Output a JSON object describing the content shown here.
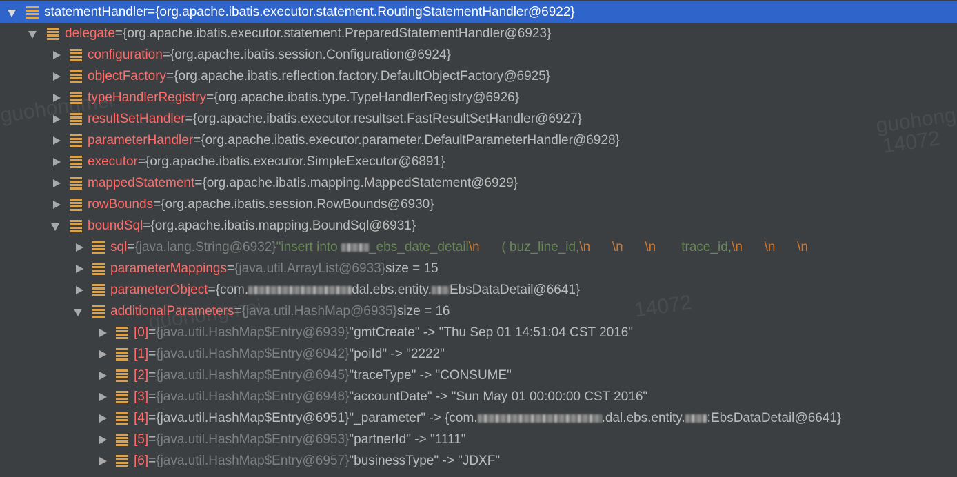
{
  "watermarks": [
    "guohongmei",
    "14072",
    "guohongmei",
    "14072",
    "guohongmei"
  ],
  "rows": [
    {
      "depth": 0,
      "state": "expanded",
      "selected": true,
      "name": "statementHandler",
      "eq": " = ",
      "value": "{org.apache.ibatis.executor.statement.RoutingStatementHandler@6922}"
    },
    {
      "depth": 1,
      "state": "expanded",
      "name": "delegate",
      "eq": " = ",
      "value": "{org.apache.ibatis.executor.statement.PreparedStatementHandler@6923}"
    },
    {
      "depth": 2,
      "state": "collapsed",
      "name": "configuration",
      "eq": " = ",
      "value": "{org.apache.ibatis.session.Configuration@6924}"
    },
    {
      "depth": 2,
      "state": "collapsed",
      "name": "objectFactory",
      "eq": " = ",
      "value": "{org.apache.ibatis.reflection.factory.DefaultObjectFactory@6925}"
    },
    {
      "depth": 2,
      "state": "collapsed",
      "name": "typeHandlerRegistry",
      "eq": " = ",
      "value": "{org.apache.ibatis.type.TypeHandlerRegistry@6926}"
    },
    {
      "depth": 2,
      "state": "collapsed",
      "name": "resultSetHandler",
      "eq": " = ",
      "value": "{org.apache.ibatis.executor.resultset.FastResultSetHandler@6927}"
    },
    {
      "depth": 2,
      "state": "collapsed",
      "name": "parameterHandler",
      "eq": " = ",
      "value": "{org.apache.ibatis.executor.parameter.DefaultParameterHandler@6928}"
    },
    {
      "depth": 2,
      "state": "collapsed",
      "name": "executor",
      "eq": " = ",
      "value": "{org.apache.ibatis.executor.SimpleExecutor@6891}"
    },
    {
      "depth": 2,
      "state": "collapsed",
      "name": "mappedStatement",
      "eq": " = ",
      "value": "{org.apache.ibatis.mapping.MappedStatement@6929}"
    },
    {
      "depth": 2,
      "state": "collapsed",
      "name": "rowBounds",
      "eq": " = ",
      "value": "{org.apache.ibatis.session.RowBounds@6930}"
    },
    {
      "depth": 2,
      "state": "expanded",
      "name": "boundSql",
      "eq": " = ",
      "value": "{org.apache.ibatis.mapping.BoundSql@6931}"
    },
    {
      "depth": 3,
      "state": "collapsed",
      "name": "sql",
      "eq": " = ",
      "type": "{java.lang.String@6932}",
      "sql": {
        "p1": "\"insert into ",
        "p2": "_ebs_date_detail",
        "esc1": "\\n",
        "p3": "      ( buz_line_id,",
        "esc2": "\\n",
        "esc3": "      \\n",
        "esc4": "      \\n",
        "p4": "       trace_id,",
        "esc5": "\\n",
        "esc6": "      \\n",
        "esc7": "      \\n"
      }
    },
    {
      "depth": 3,
      "state": "collapsed",
      "name": "parameterMappings",
      "eq": " = ",
      "type": "{java.util.ArrayList@6933}",
      "value": " size = 15"
    },
    {
      "depth": 3,
      "state": "collapsed",
      "name": "parameterObject",
      "eq": " = ",
      "po": {
        "a": "{com.",
        "b": "dal.ebs.entity.",
        "c": "EbsDataDetail@6641}"
      }
    },
    {
      "depth": 3,
      "state": "expanded",
      "name": "additionalParameters",
      "eq": " = ",
      "type": "{java.util.HashMap@6935}",
      "value": " size = 16"
    },
    {
      "depth": 4,
      "state": "collapsed",
      "name": "[0]",
      "eq": " = ",
      "type": "{java.util.HashMap$Entry@6939}",
      "value": "\"gmtCreate\" -> \"Thu Sep 01 14:51:04 CST 2016\""
    },
    {
      "depth": 4,
      "state": "collapsed",
      "name": "[1]",
      "eq": " = ",
      "type": "{java.util.HashMap$Entry@6942}",
      "value": "\"poiId\" -> \"2222\""
    },
    {
      "depth": 4,
      "state": "collapsed",
      "name": "[2]",
      "eq": " = ",
      "type": "{java.util.HashMap$Entry@6945}",
      "value": "\"traceType\" -> \"CONSUME\""
    },
    {
      "depth": 4,
      "state": "collapsed",
      "name": "[3]",
      "eq": " = ",
      "type": "{java.util.HashMap$Entry@6948}",
      "value": "\"accountDate\" -> \"Sun May 01 00:00:00 CST 2016\""
    },
    {
      "depth": 4,
      "state": "collapsed",
      "name": "[4]",
      "eq": " = ",
      "entry4": {
        "a": "{java.util.HashMap$Entry@6951}\"_parameter\" -> {com.",
        "b": ".dal.ebs.entity.",
        "c": ":EbsDataDetail@6641}"
      }
    },
    {
      "depth": 4,
      "state": "collapsed",
      "name": "[5]",
      "eq": " = ",
      "type": "{java.util.HashMap$Entry@6953}",
      "value": "\"partnerId\" -> \"1111\""
    },
    {
      "depth": 4,
      "state": "collapsed",
      "name": "[6]",
      "eq": " = ",
      "type": "{java.util.HashMap$Entry@6957}",
      "value": "\"businessType\" -> \"JDXF\""
    }
  ]
}
